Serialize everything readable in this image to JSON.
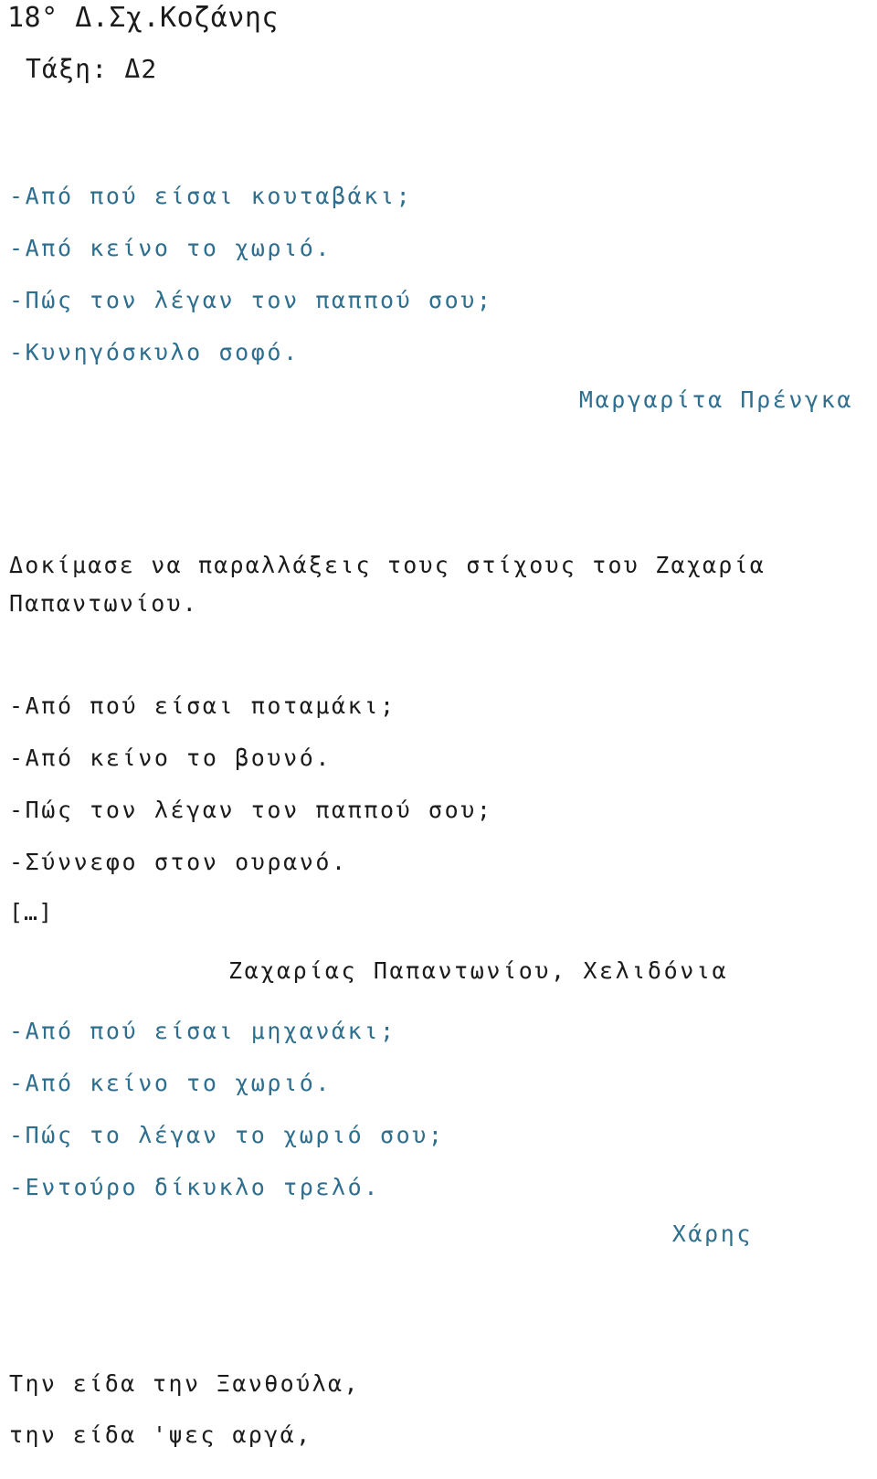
{
  "document": {
    "background_color": "#ffffff",
    "text_color_black": "#1b1b1b",
    "text_color_blue": "#2e6e8e"
  },
  "header": {
    "school": "18° Δ.Σχ.Κοζάνης",
    "class_label": "Τάξη: Δ2"
  },
  "student_poem_1": {
    "lines": [
      "-Από πού είσαι κουταβάκι;",
      "-Από κείνο το χωριό.",
      "-Πώς τον λέγαν τον παππού σου;",
      "-Κυνηγόσκυλο σοφό."
    ],
    "attribution": "Μαργαρίτα Πρένγκα"
  },
  "instruction": {
    "lines": [
      "Δοκίμασε να παραλλάξεις τους στίχους του Ζαχαρία",
      "Παπαντωνίου."
    ]
  },
  "original_poem": {
    "lines": [
      "-Από πού είσαι ποταμάκι;",
      "-Από κείνο το βουνό.",
      "-Πώς τον λέγαν τον παππού σου;",
      "-Σύννεφο στον ουρανό."
    ],
    "ellipsis_marker": "[…]",
    "attribution": "Ζαχαρίας Παπαντωνίου, Χελιδόνια"
  },
  "student_poem_2": {
    "lines": [
      "-Από πού είσαι μηχανάκι;",
      "-Από κείνο το χωριό.",
      "-Πώς το λέγαν το χωριό σου;",
      "-Εντούρο δίκυκλο τρελό."
    ],
    "attribution": "Χάρης"
  },
  "closing_couplet": {
    "lines": [
      "Την είδα την Ξανθούλα,",
      "την είδα 'ψες αργά,"
    ]
  }
}
